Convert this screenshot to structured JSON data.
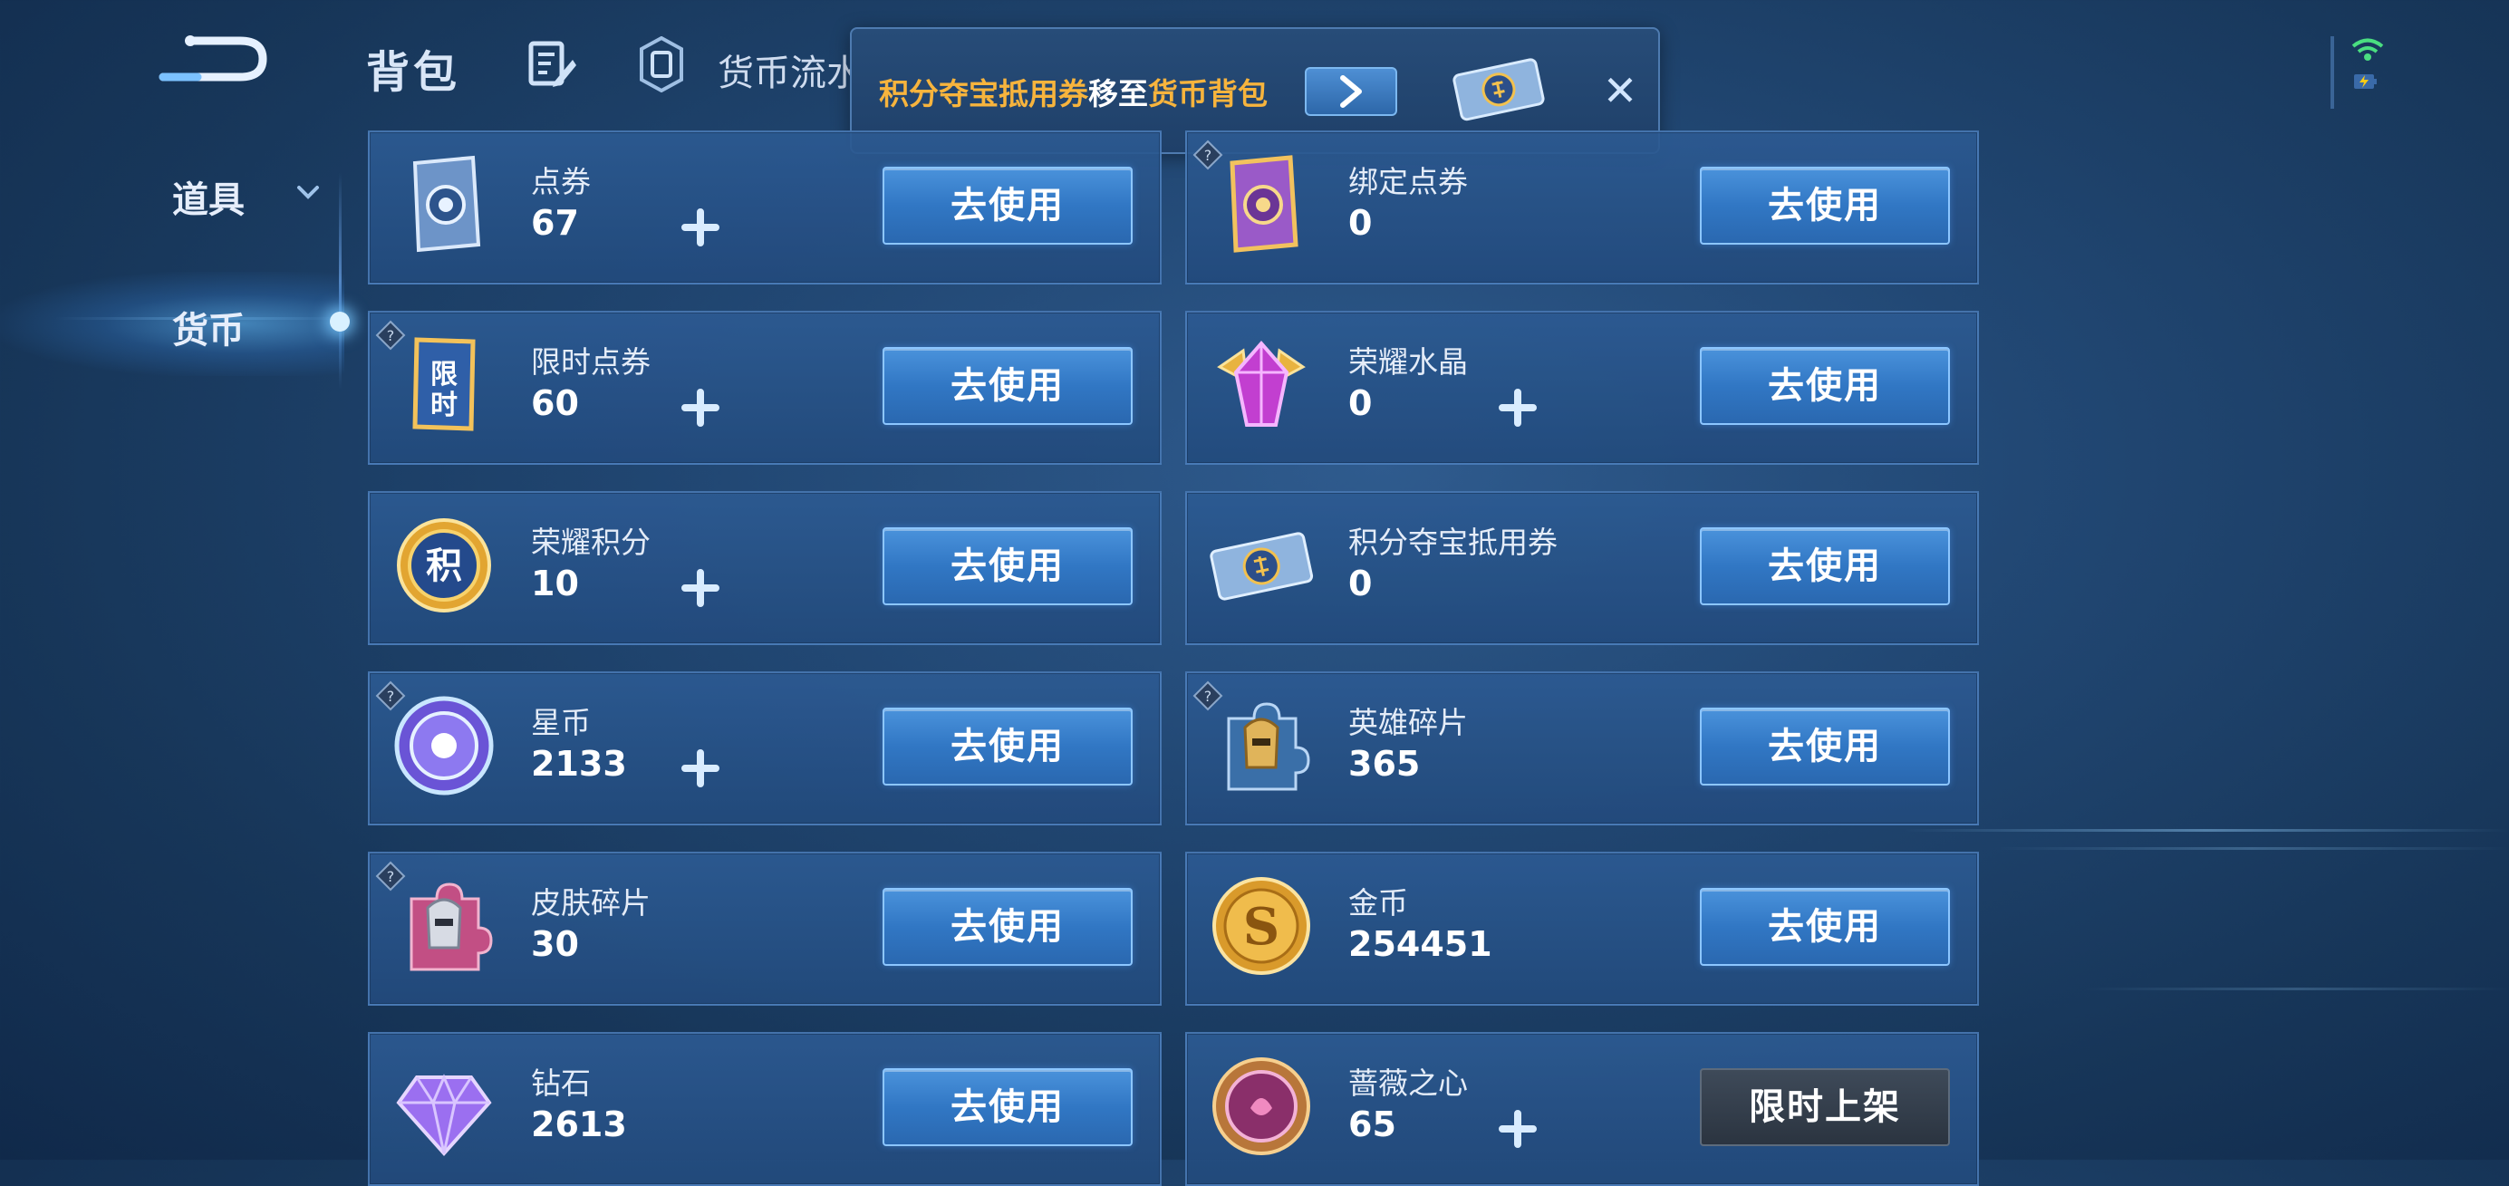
{
  "header": {
    "back_icon": "back-arrow-icon",
    "title": "背包",
    "edit_icon": "edit-icon",
    "flow_icon": "currency-flow-icon",
    "flow_label": "货币流水"
  },
  "toast": {
    "part1": "积分夺宝抵用券",
    "part2": "移至",
    "part3": "货币背包",
    "go_icon": "chevron-right-icon",
    "close_icon": "close-icon",
    "accent": "#f7b43d"
  },
  "sidebar": {
    "items": [
      {
        "label": "道具",
        "icon": "chevron-down-icon"
      },
      {
        "label": "货币",
        "active": true
      }
    ]
  },
  "currencies": {
    "left": [
      {
        "name": "点券",
        "amount": "67",
        "button": "去使用",
        "has_plus": true,
        "has_help": false,
        "icon": "voucher-icon"
      },
      {
        "name": "限时点券",
        "amount": "60",
        "button": "去使用",
        "has_plus": true,
        "has_help": true,
        "icon": "limited-voucher-icon"
      },
      {
        "name": "荣耀积分",
        "amount": "10",
        "button": "去使用",
        "has_plus": true,
        "has_help": false,
        "icon": "glory-points-icon"
      },
      {
        "name": "星币",
        "amount": "2133",
        "button": "去使用",
        "has_plus": true,
        "has_help": true,
        "icon": "star-coin-icon"
      },
      {
        "name": "皮肤碎片",
        "amount": "30",
        "button": "去使用",
        "has_plus": false,
        "has_help": true,
        "icon": "skin-fragment-icon"
      },
      {
        "name": "钻石",
        "amount": "2613",
        "button": "去使用",
        "has_plus": false,
        "has_help": false,
        "icon": "diamond-icon"
      }
    ],
    "right": [
      {
        "name": "绑定点券",
        "amount": "0",
        "button": "去使用",
        "has_plus": false,
        "has_help": true,
        "icon": "bound-voucher-icon"
      },
      {
        "name": "荣耀水晶",
        "amount": "0",
        "button": "去使用",
        "has_plus": true,
        "has_help": false,
        "icon": "glory-crystal-icon"
      },
      {
        "name": "积分夺宝抵用券",
        "amount": "0",
        "button": "去使用",
        "has_plus": false,
        "has_help": false,
        "icon": "ticket-icon"
      },
      {
        "name": "英雄碎片",
        "amount": "365",
        "button": "去使用",
        "has_plus": false,
        "has_help": true,
        "icon": "hero-fragment-icon"
      },
      {
        "name": "金币",
        "amount": "254451",
        "button": "去使用",
        "has_plus": false,
        "has_help": false,
        "icon": "gold-coin-icon"
      },
      {
        "name": "蔷薇之心",
        "amount": "65",
        "button": "限时上架",
        "has_plus": true,
        "has_help": false,
        "icon": "rose-heart-icon"
      }
    ]
  }
}
